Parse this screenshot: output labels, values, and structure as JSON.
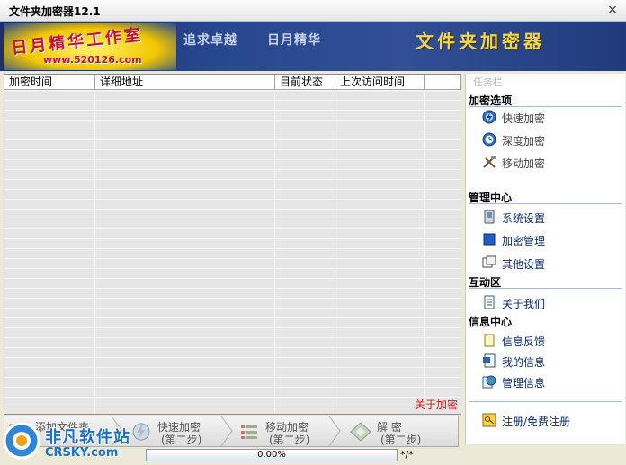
{
  "window": {
    "title": "文件夹加密器12.1",
    "close_glyph": "×"
  },
  "banner": {
    "logo_name": "日月精华工作室",
    "logo_url": "www.520126.com",
    "slogan1": "追求卓越",
    "slogan2": "日月精华",
    "title": "文件夹加密器"
  },
  "table": {
    "columns": [
      "加密时间",
      "详细地址",
      "目前状态",
      "上次访问时间",
      ""
    ],
    "rows": [],
    "about_link": "关于加密"
  },
  "toolbar": {
    "add": {
      "line1": "添加文件夹",
      "line2": ""
    },
    "quick": {
      "line1": "快速加密",
      "line2": "(第二步)"
    },
    "move": {
      "line1": "移动加密",
      "line2": "(第二步)"
    },
    "decrypt": {
      "line1": "解 密",
      "line2": "(第二步)"
    }
  },
  "status": {
    "progress_text": "0.00%",
    "progress_value": 0,
    "count_text": "*/*"
  },
  "watermark": {
    "cn": "非凡软件站",
    "en": "CRSKY.com"
  },
  "sidebar": {
    "ghost_label": "任务栏",
    "sections": [
      {
        "heading": "加密选项",
        "items": [
          "快速加密",
          "深度加密",
          "移动加密"
        ]
      },
      {
        "heading": "管理中心",
        "items": [
          "系统设置",
          "加密管理",
          "其他设置"
        ]
      },
      {
        "heading": "互动区",
        "items": [
          "关于我们"
        ]
      },
      {
        "heading": "信息中心",
        "items": [
          "信息反馈",
          "我的信息",
          "管理信息"
        ]
      }
    ],
    "register": "注册/免费注册"
  },
  "colors": {
    "accent": "#1b2f6e",
    "link_red": "#e2140c",
    "progress": "#3a7bd5"
  },
  "icons": {
    "quick": "lightning-disc-icon",
    "deep": "clock-disc-icon",
    "move": "tools-icon",
    "system": "device-icon",
    "manage": "blue-square-icon",
    "other": "window-icon",
    "about": "document-icon",
    "feedback": "note-icon",
    "myinfo": "word-doc-icon",
    "admininfo": "globe-icon",
    "register": "key-icon"
  }
}
